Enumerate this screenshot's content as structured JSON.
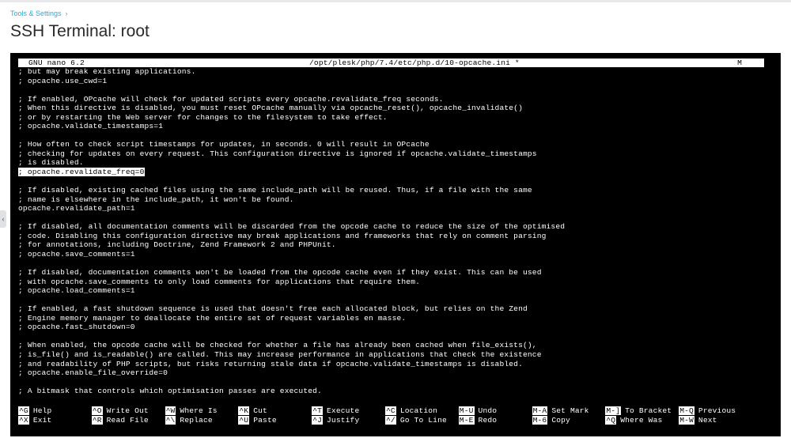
{
  "breadcrumb": {
    "parent": "Tools & Settings",
    "separator": "›"
  },
  "page": {
    "title": "SSH Terminal: root"
  },
  "colors": {
    "link": "#28aade",
    "terminal_bg": "#000000",
    "terminal_fg": "#ffffff"
  },
  "icons": {
    "collapse_handle": "chevron-left-icon"
  },
  "nano": {
    "version": "GNU nano 6.2",
    "file_path": "/opt/plesk/php/7.4/etc/php.d/10-opcache.ini *",
    "modified_flag": "M"
  },
  "editor": {
    "lines": [
      "; but may break existing applications.",
      "; opcache.use_cwd=1",
      "",
      "; If enabled, OPcache will check for updated scripts every opcache.revalidate_freq seconds.",
      "; When this directive is disabled, you must reset OPcache manually via opcache_reset(), opcache_invalidate()",
      "; or by restarting the Web server for changes to the filesystem to take effect.",
      "; opcache.validate_timestamps=1",
      "",
      "; How often to check script timestamps for updates, in seconds. 0 will result in OPcache",
      "; checking for updates on every request. This configuration directive is ignored if opcache.validate_timestamps",
      "; is disabled.",
      "; opcache.revalidate_freq=0",
      "",
      "; If disabled, existing cached files using the same include_path will be reused. Thus, if a file with the same",
      "; name is elsewhere in the include_path, it won't be found.",
      "opcache.revalidate_path=1",
      "",
      "; If disabled, all documentation comments will be discarded from the opcode cache to reduce the size of the optimised",
      "; code. Disabling this configuration directive may break applications and frameworks that rely on comment parsing",
      "; for annotations, including Doctrine, Zend Framework 2 and PHPUnit.",
      "; opcache.save_comments=1",
      "",
      "; If disabled, documentation comments won't be loaded from the opcode cache even if they exist. This can be used",
      "; with opcache.save_comments to only load comments for applications that require them.",
      "; opcache.load_comments=1",
      "",
      "; If enabled, a fast shutdown sequence is used that doesn't free each allocated block, but relies on the Zend",
      "; Engine memory manager to deallocate the entire set of request variables en masse.",
      "; opcache.fast_shutdown=0",
      "",
      "; When enabled, the opcode cache will be checked for whether a file has already been cached when file_exists(),",
      "; is_file() and is_readable() are called. This may increase performance in applications that check the existence",
      "; and readability of PHP scripts, but risks returning stale data if opcache.validate_timestamps is disabled.",
      "; opcache.enable_file_override=0",
      "",
      "; A bitmask that controls which optimisation passes are executed."
    ],
    "selected_line": 11
  },
  "shortcuts": [
    {
      "key": "^G",
      "label": "Help"
    },
    {
      "key": "^X",
      "label": "Exit"
    },
    {
      "key": "^O",
      "label": "Write Out"
    },
    {
      "key": "^R",
      "label": "Read File"
    },
    {
      "key": "^W",
      "label": "Where Is"
    },
    {
      "key": "^\\",
      "label": "Replace"
    },
    {
      "key": "^K",
      "label": "Cut"
    },
    {
      "key": "^U",
      "label": "Paste"
    },
    {
      "key": "^T",
      "label": "Execute"
    },
    {
      "key": "^J",
      "label": "Justify"
    },
    {
      "key": "^C",
      "label": "Location"
    },
    {
      "key": "^/",
      "label": "Go To Line"
    },
    {
      "key": "M-U",
      "label": "Undo"
    },
    {
      "key": "M-E",
      "label": "Redo"
    },
    {
      "key": "M-A",
      "label": "Set Mark"
    },
    {
      "key": "M-6",
      "label": "Copy"
    },
    {
      "key": "M-]",
      "label": "To Bracket"
    },
    {
      "key": "^Q",
      "label": "Where Was"
    },
    {
      "key": "M-Q",
      "label": "Previous"
    },
    {
      "key": "M-W",
      "label": "Next"
    }
  ]
}
